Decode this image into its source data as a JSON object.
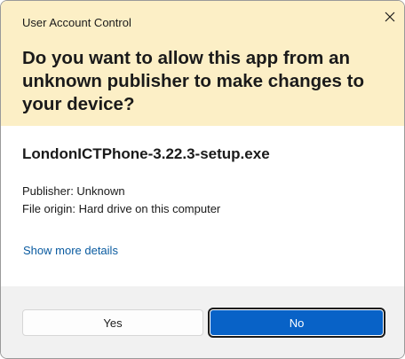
{
  "window": {
    "title": "User Account Control"
  },
  "header": {
    "question": "Do you want to allow this app from an unknown publisher to make changes to your device?"
  },
  "content": {
    "filename": "LondonICTPhone-3.22.3-setup.exe",
    "publisher": "Publisher: Unknown",
    "file_origin": "File origin: Hard drive on this computer",
    "more_details_link": "Show more details"
  },
  "buttons": {
    "yes": "Yes",
    "no": "No"
  },
  "icons": {
    "close": "close-icon"
  },
  "colors": {
    "header_bg": "#fcefc6",
    "primary_button": "#0862c7",
    "link": "#0a5ba0",
    "footer_bg": "#f1f1f1"
  }
}
